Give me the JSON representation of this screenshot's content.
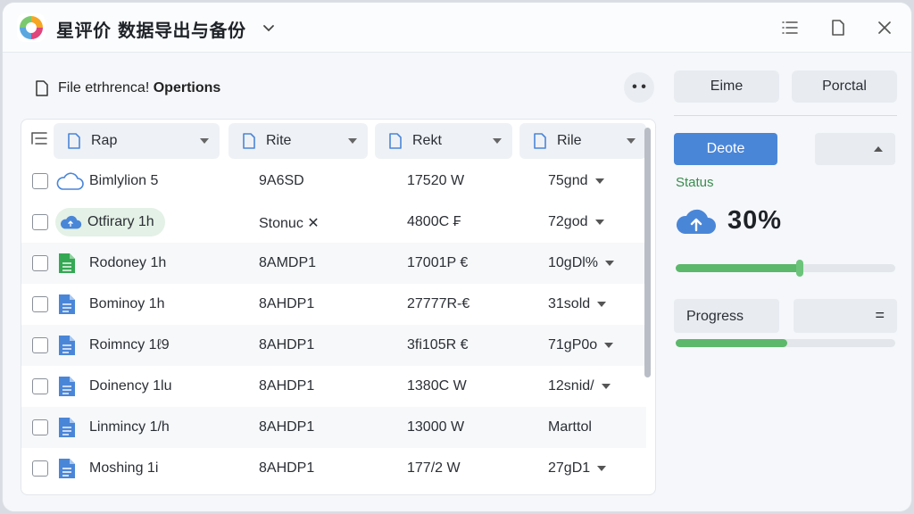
{
  "app": {
    "title": "星评价 数据导出与备份"
  },
  "panel": {
    "header_prefix": "File etrhrenca!",
    "header_bold": "Opertions",
    "more_label": "• •"
  },
  "table": {
    "columns": [
      {
        "label": "Rap"
      },
      {
        "label": "Rite"
      },
      {
        "label": "Rekt"
      },
      {
        "label": "Rile"
      }
    ],
    "rows": [
      {
        "name": "Bimlylion 5",
        "col2": "9A6SD",
        "col3": "17520 W",
        "col4": "75gnd",
        "icon": "cloud-icon"
      },
      {
        "name": "Otfirary 1h",
        "col2": "Stonuc ✕",
        "col3": "4800C ₣",
        "col4": "72god",
        "icon": "cloud-icon"
      },
      {
        "name": "Rodoney 1h",
        "col2": "8AMDP1",
        "col3": "17001P €",
        "col4": "10gDl%",
        "icon": "sheet-file-icon"
      },
      {
        "name": "Bominoy 1h",
        "col2": "8AHDP1",
        "col3": "27777R-€",
        "col4": "31sold",
        "icon": "doc-file-icon"
      },
      {
        "name": "Roimncy 1ℓ9",
        "col2": "8AHDP1",
        "col3": "3fi105R €",
        "col4": "71gP0o",
        "icon": "doc-file-icon"
      },
      {
        "name": "Doinency 1lu",
        "col2": "8AHDP1",
        "col3": "1380C W",
        "col4": "12snid/",
        "icon": "doc-file-icon"
      },
      {
        "name": "Linmincy 1/h",
        "col2": "8AHDP1",
        "col3": "13000 W",
        "col4": "Marttol",
        "icon": "doc-file-icon"
      },
      {
        "name": "Moshing 1i",
        "col2": "8AHDP1",
        "col3": "177/2 W",
        "col4": "27gD1",
        "icon": "doc-file-icon"
      }
    ]
  },
  "right": {
    "btn_a": "Eime",
    "btn_b": "Porctal",
    "primary_btn": "Deote",
    "status_label": "Status",
    "percent_text": "30%",
    "slider_fraction": 0.57,
    "progress_label": "Progress",
    "progress_eq": "=",
    "progress_fraction": 0.51
  },
  "colors": {
    "accent": "#4a86d8",
    "success": "#5cb86b",
    "status_text": "#3a8b4f"
  }
}
